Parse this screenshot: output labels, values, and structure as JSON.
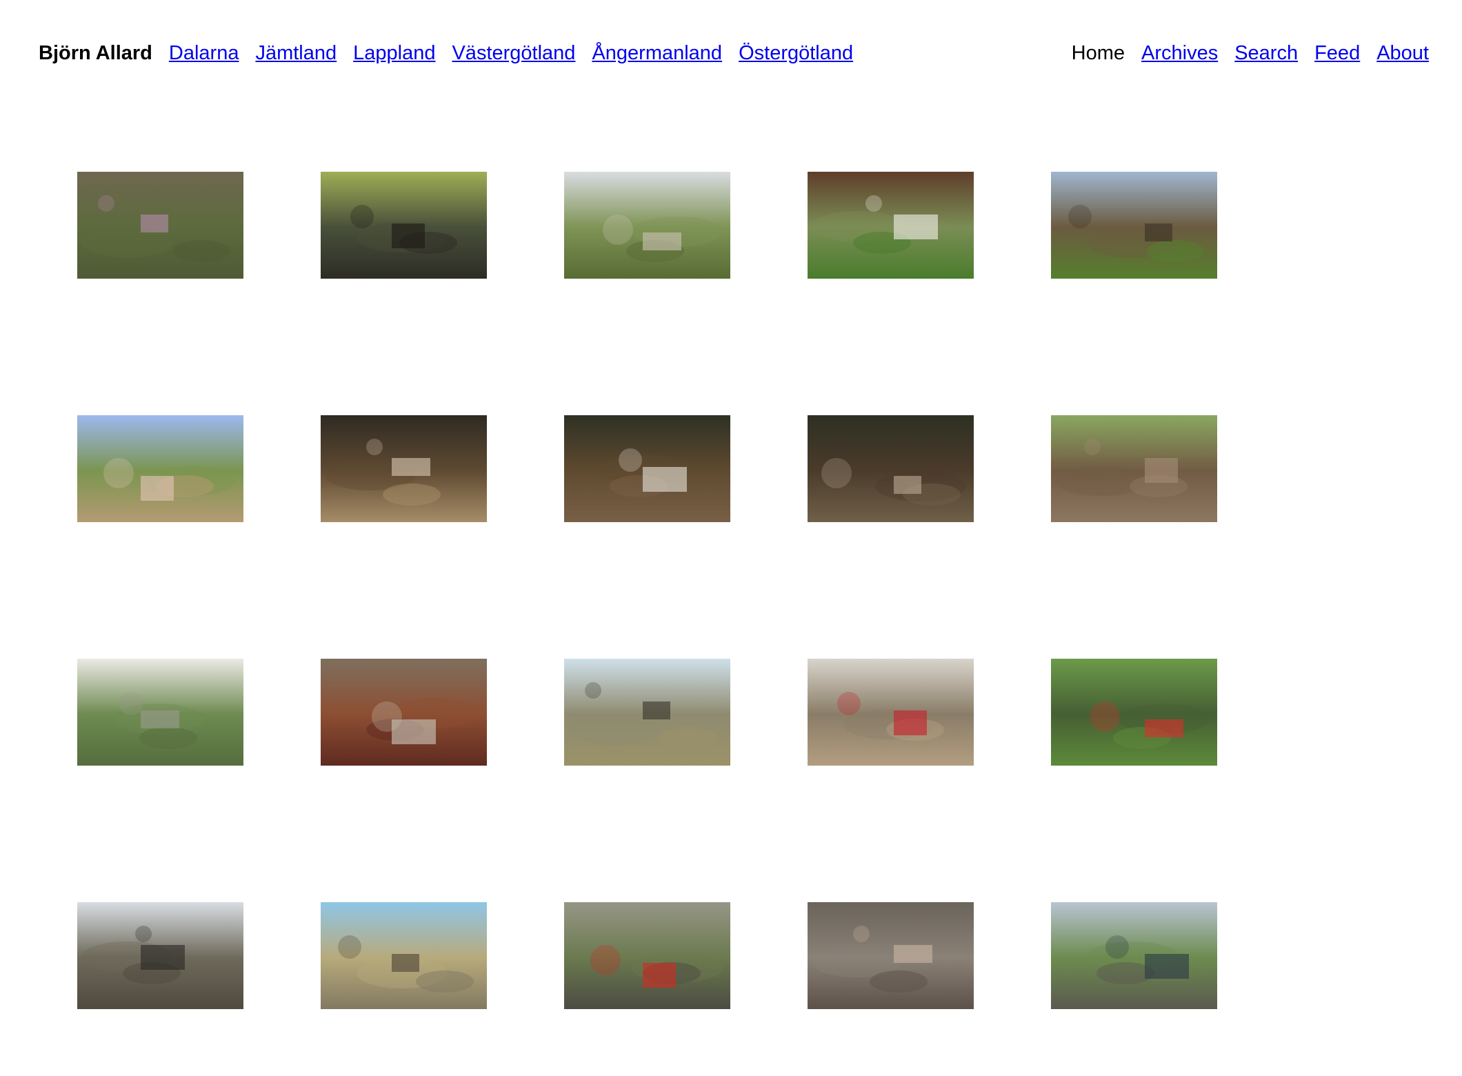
{
  "site": {
    "brand": "Björn Allard",
    "regions": [
      "Dalarna",
      "Jämtland",
      "Lappland",
      "Västergötland",
      "Ångermanland",
      "Östergötland"
    ],
    "current_page": "Home",
    "links": [
      "Archives",
      "Search",
      "Feed",
      "About"
    ]
  },
  "gallery": {
    "photos": [
      {
        "top": "#6f6750",
        "mid": "#5c6b3d",
        "bottom": "#4f5a34",
        "accent": "#b58aa9",
        "icon": "heather-landscape"
      },
      {
        "top": "#9fae55",
        "mid": "#49503a",
        "bottom": "#2d2c25",
        "accent": "#1d1a15",
        "icon": "forest-stones"
      },
      {
        "top": "#d9dce0",
        "mid": "#7f9456",
        "bottom": "#586b34",
        "accent": "#c9c2b3",
        "icon": "farm-road"
      },
      {
        "top": "#5f3e2b",
        "mid": "#7b8d55",
        "bottom": "#4a7c2c",
        "accent": "#f2efe8",
        "icon": "red-cottage"
      },
      {
        "top": "#9fb6cf",
        "mid": "#6b5b40",
        "bottom": "#567f2d",
        "accent": "#3c3226",
        "icon": "orchard-house"
      },
      {
        "top": "#9db8ef",
        "mid": "#7b9550",
        "bottom": "#b59a72",
        "accent": "#e3c4b6",
        "icon": "country-road"
      },
      {
        "top": "#2f2a22",
        "mid": "#5f4a32",
        "bottom": "#a68d68",
        "accent": "#d7c7b2",
        "icon": "forest-excavation"
      },
      {
        "top": "#2e3124",
        "mid": "#5f4a30",
        "bottom": "#786046",
        "accent": "#e5e0d7",
        "icon": "forest-trench"
      },
      {
        "top": "#2d3023",
        "mid": "#4b3b2b",
        "bottom": "#6f6049",
        "accent": "#b8a893",
        "icon": "forest-dig"
      },
      {
        "top": "#8aa760",
        "mid": "#725b44",
        "bottom": "#8d7761",
        "accent": "#a48d77",
        "icon": "stone-mound"
      },
      {
        "top": "#ece9e4",
        "mid": "#6e8b52",
        "bottom": "#556d3d",
        "accent": "#9a9b8c",
        "icon": "tractor"
      },
      {
        "top": "#7f6f5d",
        "mid": "#8d4f33",
        "bottom": "#5f2a20",
        "accent": "#c9c6bb",
        "icon": "corroded-metal"
      },
      {
        "top": "#cfe0ea",
        "mid": "#8f8b70",
        "bottom": "#9b9268",
        "accent": "#39362b",
        "icon": "flat-field-cairn"
      },
      {
        "top": "#d8d4cc",
        "mid": "#8a7d68",
        "bottom": "#b29d80",
        "accent": "#c81f2b",
        "icon": "archaeologist-measuring"
      },
      {
        "top": "#6c9a4a",
        "mid": "#465f34",
        "bottom": "#5d8a3a",
        "accent": "#d82f2b",
        "icon": "aerial-stone-circle"
      },
      {
        "top": "#d8dde3",
        "mid": "#6e6a5a",
        "bottom": "#4f4a3f",
        "accent": "#2a2825",
        "icon": "machine-lifting-stones"
      },
      {
        "top": "#8fc6e6",
        "mid": "#b7aa7b",
        "bottom": "#827962",
        "accent": "#4c4639",
        "icon": "field-digging"
      },
      {
        "top": "#969686",
        "mid": "#6b7a4f",
        "bottom": "#4c4b42",
        "accent": "#d12b22",
        "icon": "red-tripod"
      },
      {
        "top": "#6b645b",
        "mid": "#8a8177",
        "bottom": "#5d5149",
        "accent": "#c9b59f",
        "icon": "stone-pit"
      },
      {
        "top": "#b9c4d2",
        "mid": "#6d8b4f",
        "bottom": "#5a5a4f",
        "accent": "#2b3a45",
        "icon": "field-machinery"
      }
    ]
  }
}
